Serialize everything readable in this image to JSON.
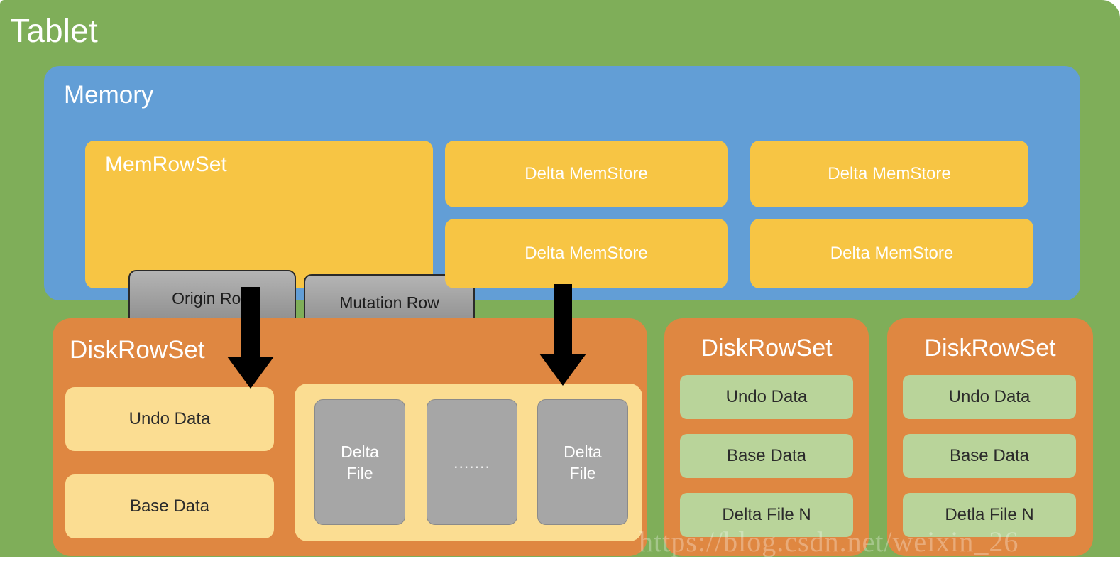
{
  "tablet": {
    "title": "Tablet",
    "color": "#7fae59"
  },
  "memory": {
    "title": "Memory",
    "color": "#629ed6",
    "memrowset": {
      "title": "MemRowSet",
      "color": "#f7c544",
      "rows": [
        {
          "label": "Origin Row"
        },
        {
          "label": "Mutation Row"
        }
      ]
    },
    "delta_memstores": [
      {
        "label": "Delta MemStore"
      },
      {
        "label": "Delta MemStore"
      },
      {
        "label": "Delta MemStore"
      },
      {
        "label": "Delta MemStore"
      }
    ]
  },
  "diskrowsets": {
    "color": "#df8741",
    "main": {
      "title": "DiskRowSet",
      "chips": [
        {
          "label": "Undo Data"
        },
        {
          "label": "Base Data"
        }
      ],
      "delta_panel": {
        "files": [
          {
            "line1": "Delta",
            "line2": "File"
          },
          {
            "dots": "......."
          },
          {
            "line1": "Delta",
            "line2": "File"
          }
        ]
      }
    },
    "secondary": [
      {
        "title": "DiskRowSet",
        "chips": [
          {
            "label": "Undo Data"
          },
          {
            "label": "Base Data"
          },
          {
            "label": "Delta File N"
          }
        ]
      },
      {
        "title": "DiskRowSet",
        "chips": [
          {
            "label": "Undo Data"
          },
          {
            "label": "Base Data"
          },
          {
            "label": "Detla File N"
          }
        ]
      }
    ]
  },
  "watermark": {
    "text": "https://blog.csdn.net/weixin_26"
  }
}
